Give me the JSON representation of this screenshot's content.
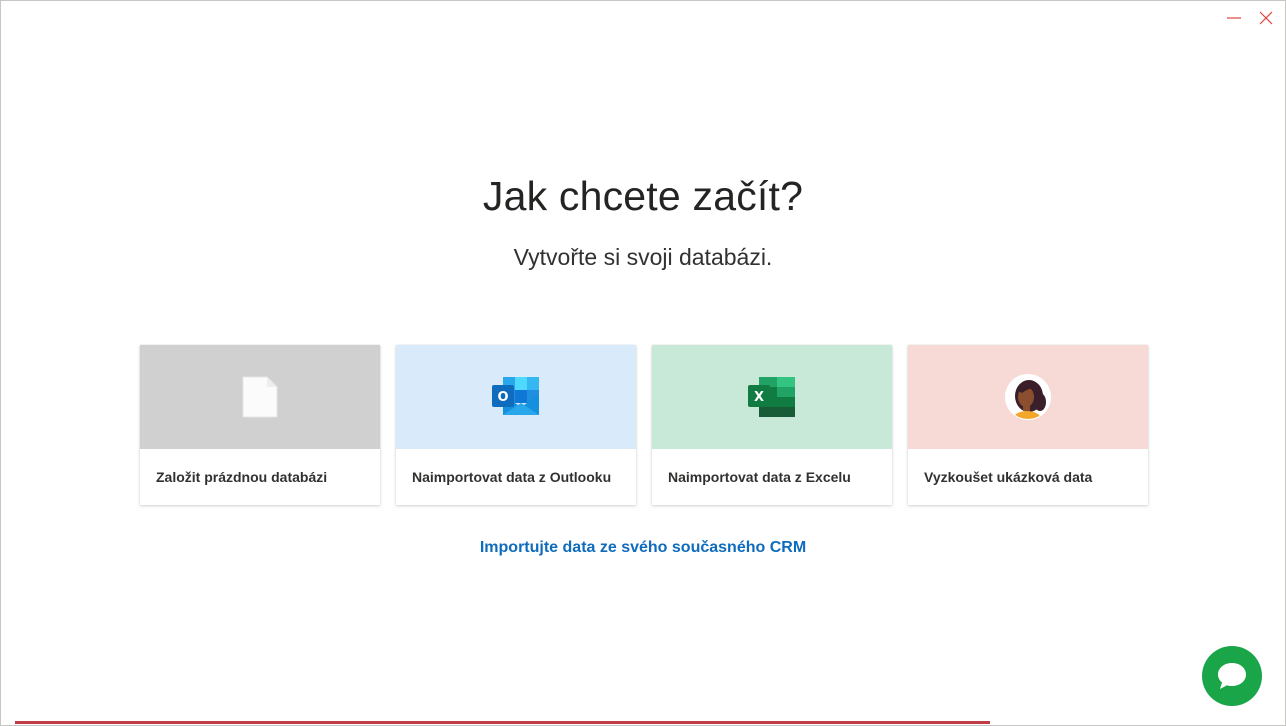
{
  "heading": "Jak chcete začít?",
  "subheading": "Vytvořte si svoji databázi.",
  "cards": [
    {
      "label": "Založit prázdnou databázi",
      "icon": "blank-document-icon",
      "color": "#d0d0d0"
    },
    {
      "label": "Naimportovat data z Outlooku",
      "icon": "outlook-icon",
      "color": "#d9ebfb"
    },
    {
      "label": "Naimportovat data z Excelu",
      "icon": "excel-icon",
      "color": "#c8e9d7"
    },
    {
      "label": "Vyzkoušet ukázková data",
      "icon": "person-avatar-icon",
      "color": "#f7dad6"
    }
  ],
  "crm_link": "Importujte data ze svého současného CRM",
  "colors": {
    "link": "#0f6cbd",
    "chat": "#1aa548",
    "window_controls": "#e0443d",
    "progress": "#c23b45"
  }
}
